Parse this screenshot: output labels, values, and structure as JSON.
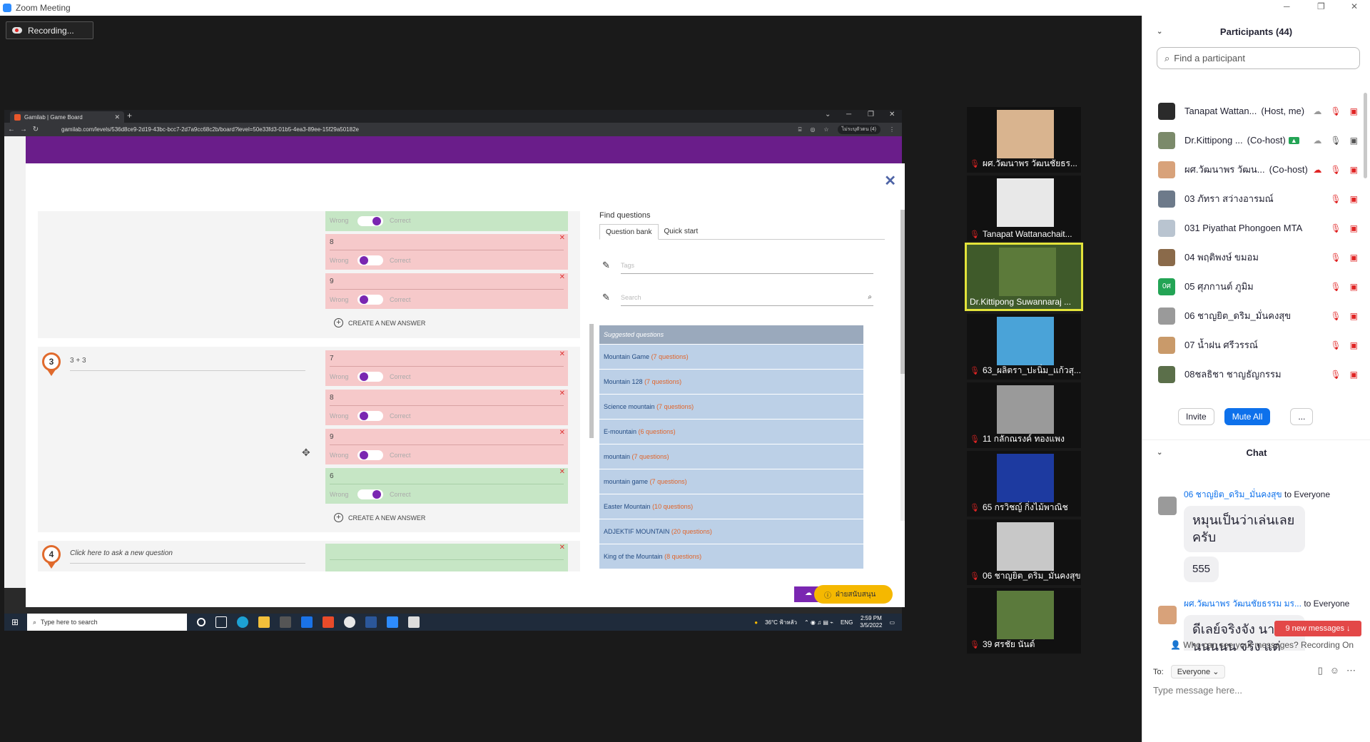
{
  "window": {
    "title": "Zoom Meeting"
  },
  "recording": {
    "label": "Recording..."
  },
  "browser": {
    "tab_title": "Gamilab | Game Board",
    "url": "gamilab.com/levels/536d8ce9-2d19-43bc-bcc7-2d7a9cc68c2b/board?level=50e33fd3-01b5-4ea3-89ee-15f29a50182e",
    "profile": "ไม่ระบุตัวตน (4)"
  },
  "editor": {
    "close_glyph": "✕",
    "create_answer_label": "CREATE A NEW ANSWER",
    "wrong_label": "Wrong",
    "correct_label": "Correct",
    "q2_answers": [
      {
        "num": "",
        "state": "correct"
      },
      {
        "num": "8",
        "state": "wrong"
      },
      {
        "num": "9",
        "state": "wrong"
      }
    ],
    "q3": {
      "number": "3",
      "text": "3 + 3",
      "answers": [
        {
          "num": "7",
          "state": "wrong"
        },
        {
          "num": "8",
          "state": "wrong"
        },
        {
          "num": "9",
          "state": "wrong"
        },
        {
          "num": "6",
          "state": "correct"
        }
      ]
    },
    "q4": {
      "number": "4",
      "placeholder": "Click here to ask a new question"
    }
  },
  "find": {
    "title": "Find questions",
    "tabs": [
      "Question bank",
      "Quick start"
    ],
    "tags_placeholder": "Tags",
    "search_placeholder": "Search",
    "suggested_header": "Suggested questions",
    "suggested": [
      {
        "name": "Mountain Game",
        "count": "(7 questions)"
      },
      {
        "name": "Mountain 128",
        "count": "(7 questions)"
      },
      {
        "name": "Science mountain",
        "count": "(7 questions)"
      },
      {
        "name": "E-mountain",
        "count": "(6 questions)"
      },
      {
        "name": "mountain",
        "count": "(7 questions)"
      },
      {
        "name": "mountain game",
        "count": "(7 questions)"
      },
      {
        "name": "Easter Mountain",
        "count": "(10 questions)"
      },
      {
        "name": "ADJEKTIF MOUNTAIN",
        "count": "(20 questions)"
      },
      {
        "name": "King of the Mountain",
        "count": "(8 questions)"
      }
    ],
    "help_label": "ฝ่ายสนับสนุน"
  },
  "taskbar": {
    "search_placeholder": "Type here to search",
    "weather": "36°C ฟ้าหลัว",
    "lang": "ENG",
    "time": "2:59 PM",
    "date": "3/5/2022"
  },
  "gallery": [
    {
      "name": "ผศ.วัฒนาพร วัฒนชัยธร...",
      "color": "#d9b48f",
      "active": false
    },
    {
      "name": "Tanapat Wattanachait...",
      "color": "#e8e8e8",
      "active": false
    },
    {
      "name": "Dr.Kittipong Suwannaraj ...",
      "color": "#5c7a3a",
      "active": true
    },
    {
      "name": "63_ผลิตรา_ปะนิ่ม_แก้วสุ...",
      "color": "#4aa3d8",
      "active": false
    },
    {
      "name": "11 กลักณรงค์ ทองแพง",
      "color": "#9a9a9a",
      "active": false
    },
    {
      "name": "65 กรวิชญ์ กิ่งไม้พาณิช",
      "color": "#1d3aa0",
      "active": false
    },
    {
      "name": "06 ชาญยิต_ดริม_มั่นคงสุข",
      "color": "#c8c8c8",
      "active": false
    },
    {
      "name": "39 ศรชัย นันต์",
      "color": "#5b7a3c",
      "active": false
    }
  ],
  "participants": {
    "title": "Participants (44)",
    "search_placeholder": "Find a participant",
    "list": [
      {
        "name": "Tanapat Wattan...",
        "role": "(Host, me)",
        "color": "#2b2b2b"
      },
      {
        "name": "Dr.Kittipong ...",
        "role": "(Co-host)",
        "color": "#7b8a6a"
      },
      {
        "name": "ผศ.วัฒนาพร วัฒน...",
        "role": "(Co-host)",
        "color": "#d8a27a"
      },
      {
        "name": "03 ภัทรา สว่างอารมณ์",
        "role": "",
        "color": "#6d7a8a"
      },
      {
        "name": "031 Piyathat Phongoen MTA",
        "role": "",
        "color": "#b9c4d0"
      },
      {
        "name": "04 พฤติพงษ์ ขมอม",
        "role": "",
        "color": "#8a6a4a"
      },
      {
        "name": "05 ศุภกานต์ ภูมิม",
        "role": "",
        "color": "#23a455"
      },
      {
        "name": "06 ชาญยิต_ดริม_มั่นคงสุข",
        "role": "",
        "color": "#9a9a9a"
      },
      {
        "name": "07 น้ำฝน ศรีวรรณ์",
        "role": "",
        "color": "#c99a6a"
      },
      {
        "name": "08ชลธิชา ชาญธัญกรรม",
        "role": "",
        "color": "#5b6f4a"
      }
    ],
    "av_text_05": "0ศ",
    "invite": "Invite",
    "mute_all": "Mute All",
    "more": "..."
  },
  "chat": {
    "title": "Chat",
    "messages": [
      {
        "from": "06 ชาญยิต_ดริม_มั่นคงสุข",
        "to": "to Everyone",
        "lines": [
          "หมุนเป็นว่าเล่นเลยครับ",
          "555"
        ]
      },
      {
        "from": "ผศ.วัฒนาพร วัฒนชัยธรรม มร...",
        "to": "to Everyone",
        "lines": [
          "ดีเลย์จริงจัง นานนนนนน จริง แต่"
        ]
      }
    ],
    "new_messages": "9 new messages ↓",
    "who_can_see": "Who can see your messages? Recording On",
    "to_label": "To:",
    "to_value": "Everyone",
    "placeholder": "Type message here..."
  }
}
